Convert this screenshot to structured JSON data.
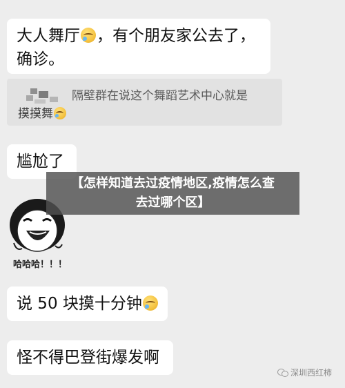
{
  "messages": [
    {
      "line1": "大人舞厅",
      "line1_after": "，有个朋友家公去了，",
      "line2": "确诊。"
    },
    {
      "text": "尴尬了"
    },
    {
      "text_before": "说 50 块摸十分钟"
    },
    {
      "text": "怪不得巴登街爆发啊"
    }
  ],
  "quote": {
    "text": "隔壁群在说这个舞蹈艺术中心就是",
    "sub": "摸摸舞"
  },
  "overlay": {
    "line1": "【怎样知道去过疫情地区,疫情怎么查",
    "line2": "去过哪个区】"
  },
  "sticker": {
    "caption": "哈哈哈！！！"
  },
  "watermark": {
    "text": "深圳西红柿",
    "icon": "wechat-icon"
  },
  "emoji_name": "face-with-tears-emoji"
}
